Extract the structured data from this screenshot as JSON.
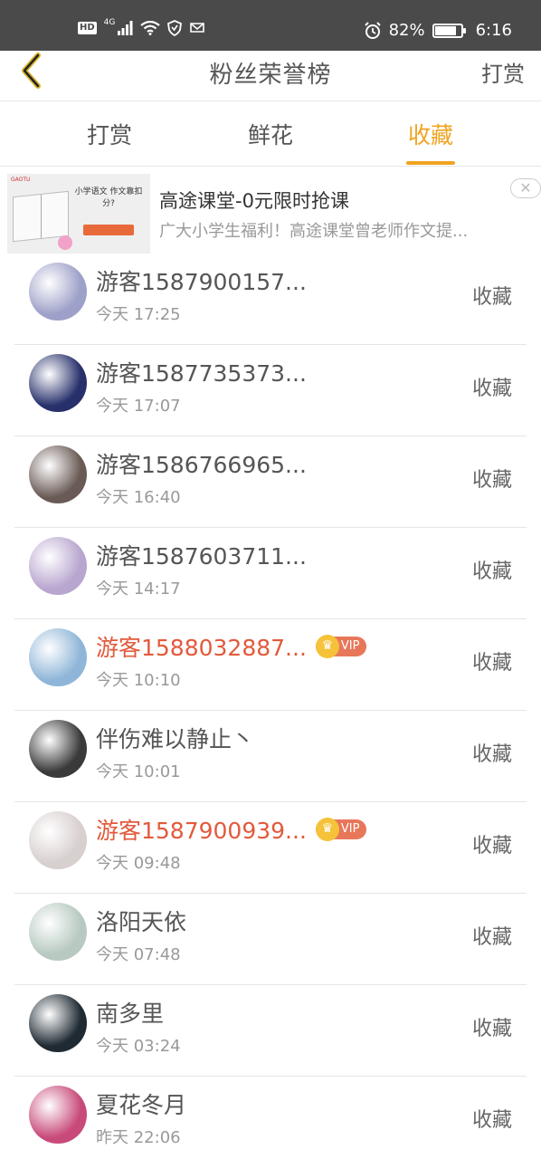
{
  "status_bar": {
    "hd": "HD",
    "network": "4G",
    "battery": "82%",
    "battery_level": 0.82,
    "time": "6:16"
  },
  "header": {
    "title": "粉丝荣誉榜",
    "action": "打赏"
  },
  "tabs": [
    {
      "label": "打赏",
      "active": false
    },
    {
      "label": "鲜花",
      "active": false
    },
    {
      "label": "收藏",
      "active": true
    }
  ],
  "ad": {
    "image_text": "小学语文 作文靠扣分?",
    "title": "高途课堂-0元限时抢课",
    "description": "广大小学生福利！高途课堂曾老师作文提...",
    "close": "✕"
  },
  "list": [
    {
      "name": "游客1587900157...",
      "time": "今天 17:25",
      "vip": false,
      "vip_label": "",
      "action": "收藏",
      "avatar_color": "#9da0c8"
    },
    {
      "name": "游客1587735373...",
      "time": "今天 17:07",
      "vip": false,
      "vip_label": "",
      "action": "收藏",
      "avatar_color": "#27306b"
    },
    {
      "name": "游客1586766965...",
      "time": "今天 16:40",
      "vip": false,
      "vip_label": "",
      "action": "收藏",
      "avatar_color": "#6a5a55"
    },
    {
      "name": "游客1587603711...",
      "time": "今天 14:17",
      "vip": false,
      "vip_label": "",
      "action": "收藏",
      "avatar_color": "#b8a6cf"
    },
    {
      "name": "游客1588032887...",
      "time": "今天 10:10",
      "vip": true,
      "vip_label": "VIP",
      "action": "收藏",
      "avatar_color": "#8fb6d8"
    },
    {
      "name": "伴伤难以静止丶",
      "time": "今天 10:01",
      "vip": false,
      "vip_label": "",
      "action": "收藏",
      "avatar_color": "#3a3a3a"
    },
    {
      "name": "游客1587900939...",
      "time": "今天 09:48",
      "vip": true,
      "vip_label": "VIP",
      "action": "收藏",
      "avatar_color": "#d8cfcf"
    },
    {
      "name": "洛阳天依",
      "time": "今天 07:48",
      "vip": false,
      "vip_label": "",
      "action": "收藏",
      "avatar_color": "#b7c9c0"
    },
    {
      "name": "南多里",
      "time": "今天 03:24",
      "vip": false,
      "vip_label": "",
      "action": "收藏",
      "avatar_color": "#1f2a33"
    },
    {
      "name": "夏花冬月",
      "time": "昨天 22:06",
      "vip": false,
      "vip_label": "",
      "action": "收藏",
      "avatar_color": "#c84a7a"
    }
  ],
  "colors": {
    "accent": "#f0a321",
    "vip_name": "#e25a3c",
    "status_bar": "#4a4a4a"
  }
}
